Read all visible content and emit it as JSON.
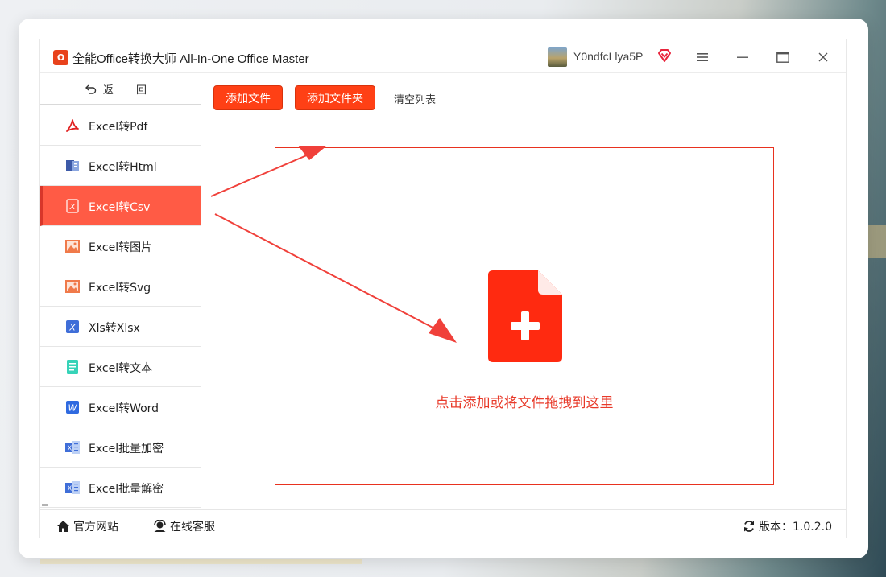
{
  "app": {
    "logo_text": "O",
    "title": "全能Office转换大师 All-In-One Office Master",
    "username": "Y0ndfcLlya5P",
    "accent_color": "#ff4015"
  },
  "window_controls": {
    "menu_icon": "hamburger-icon",
    "minimize_icon": "minimize-icon",
    "maximize_icon": "maximize-icon",
    "close_icon": "close-icon"
  },
  "sidebar": {
    "back_label": "返 回",
    "items": [
      {
        "label": "Excel转Pdf",
        "icon": "pdf-icon"
      },
      {
        "label": "Excel转Html",
        "icon": "html-icon"
      },
      {
        "label": "Excel转Csv",
        "icon": "csv-icon",
        "active": true
      },
      {
        "label": "Excel转图片",
        "icon": "image-icon"
      },
      {
        "label": "Excel转Svg",
        "icon": "svg-image-icon"
      },
      {
        "label": "Xls转Xlsx",
        "icon": "xlsx-icon"
      },
      {
        "label": "Excel转文本",
        "icon": "text-doc-icon"
      },
      {
        "label": "Excel转Word",
        "icon": "word-icon"
      },
      {
        "label": "Excel批量加密",
        "icon": "excel-lock-icon"
      },
      {
        "label": "Excel批量解密",
        "icon": "excel-unlock-icon"
      }
    ]
  },
  "toolbar": {
    "add_file": "添加文件",
    "add_folder": "添加文件夹",
    "clear_list": "清空列表"
  },
  "dropzone": {
    "text": "点击添加或将文件拖拽到这里"
  },
  "footer": {
    "website": "官方网站",
    "support": "在线客服",
    "version": "版本：1.0.2.0"
  }
}
